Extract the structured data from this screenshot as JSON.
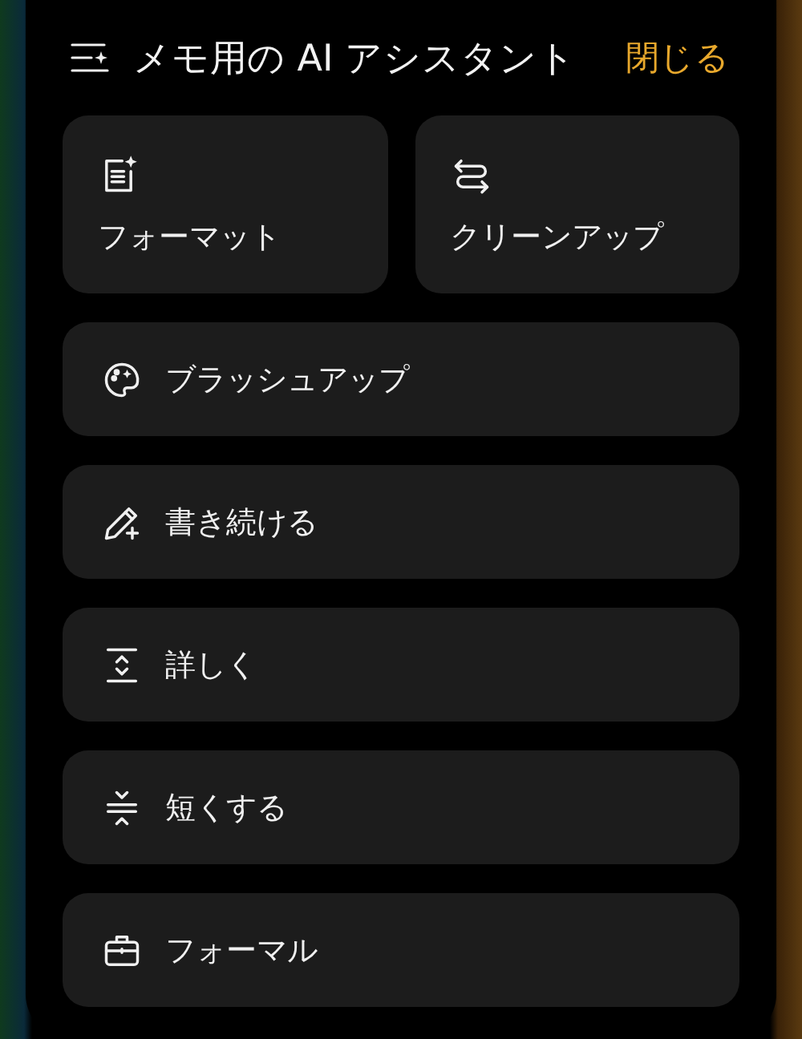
{
  "header": {
    "title": "メモ用の AI アシスタント",
    "close": "閉じる"
  },
  "tiles": [
    {
      "label": "フォーマット"
    },
    {
      "label": "クリーンアップ"
    }
  ],
  "actions": [
    {
      "label": "ブラッシュアップ"
    },
    {
      "label": "書き続ける"
    },
    {
      "label": "詳しく"
    },
    {
      "label": "短くする"
    },
    {
      "label": "フォーマル"
    }
  ]
}
